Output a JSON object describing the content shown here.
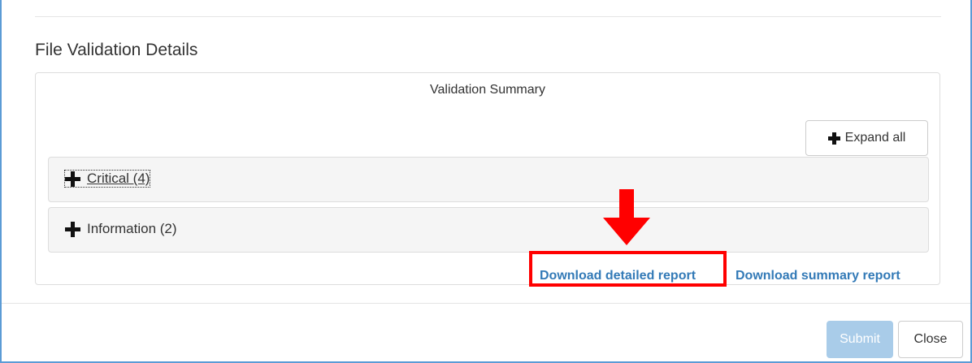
{
  "section": {
    "title": "File Validation Details"
  },
  "panel": {
    "heading": "Validation Summary",
    "expand_all_label": "Expand all",
    "groups": [
      {
        "label": "Critical (4)",
        "icon": "plus-icon"
      },
      {
        "label": "Information (2)",
        "icon": "plus-icon"
      }
    ],
    "links": {
      "detailed": "Download detailed report",
      "summary": "Download summary report"
    }
  },
  "annotation": {
    "color": "#ff0000",
    "target": "Download detailed report"
  },
  "footer": {
    "submit_label": "Submit",
    "close_label": "Close"
  },
  "colors": {
    "link": "#337ab7",
    "submit_disabled": "#a9cce9",
    "frame_border": "#5b9bd5"
  }
}
